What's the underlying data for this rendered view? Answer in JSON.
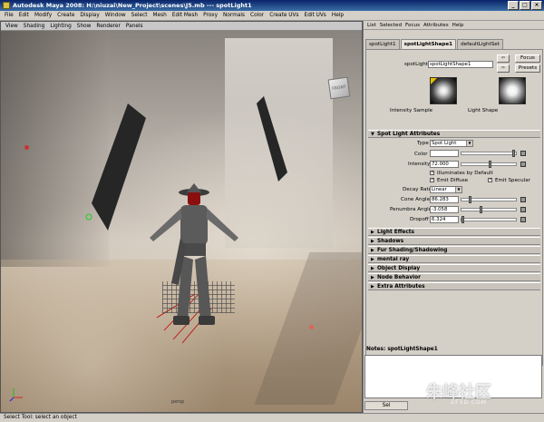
{
  "window": {
    "title": "Autodesk Maya 2008: H:\\niuzai\\New_Project\\scenes\\J5.mb   ---   spotLight1",
    "minimize": "_",
    "maximize": "□",
    "close": "×"
  },
  "menubar": [
    "File",
    "Edit",
    "Modify",
    "Create",
    "Display",
    "Window",
    "Select",
    "Mesh",
    "Edit Mesh",
    "Proxy",
    "Normals",
    "Color",
    "Create UVs",
    "Edit UVs",
    "Help"
  ],
  "viewport": {
    "menus": [
      "View",
      "Shading",
      "Lighting",
      "Show",
      "Renderer",
      "Panels"
    ],
    "camera_label": "persp",
    "viewcube_label": "FRONT"
  },
  "attribute_editor": {
    "menus": [
      "List",
      "Selected",
      "Focus",
      "Attributes",
      "Help"
    ],
    "tabs": [
      "spotLight1",
      "spotLightShape1",
      "defaultLightSet"
    ],
    "active_tab": 1,
    "node_label": "spotLight:",
    "node_name": "spotLightShape1",
    "focus_button": "Focus",
    "presets_button": "Presets",
    "intensity_sample_label": "Intensity Sample",
    "light_shape_label": "Light Shape",
    "spot_section": "Spot Light Attributes",
    "type_label": "Type",
    "type_value": "Spot Light",
    "color_label": "Color",
    "intensity_label": "Intensity",
    "intensity_value": "72.000",
    "illum_default": "Illuminates by Default",
    "emit_diffuse": "Emit Diffuse",
    "emit_specular": "Emit Specular",
    "decay_label": "Decay Rate",
    "decay_value": "Linear",
    "cone_label": "Cone Angle",
    "cone_value": "86.283",
    "penumbra_label": "Penumbra Angle",
    "penumbra_value": "-3.058",
    "dropoff_label": "Dropoff",
    "dropoff_value": "6.324",
    "collapsed_sections": [
      "Light Effects",
      "Shadows",
      "Fur Shading/Shadowing",
      "mental ray",
      "Object Display",
      "Node Behavior",
      "Extra Attributes"
    ],
    "checkmark": "✓"
  },
  "notes": {
    "label": "Notes:  spotLightShape1",
    "select_button": "Sel"
  },
  "statusbar": {
    "text": "Select Tool: select an object"
  },
  "watermark": {
    "main": "朱峰社区",
    "sub": "ZF3D.COM"
  }
}
